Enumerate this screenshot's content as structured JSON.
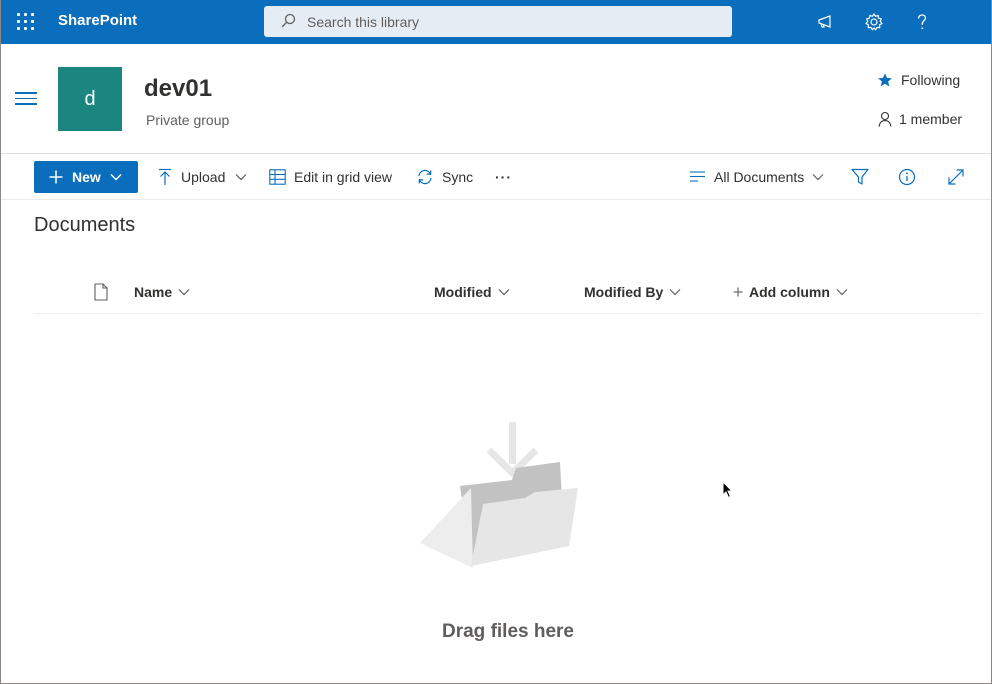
{
  "suite_bar": {
    "brand": "SharePoint",
    "search_placeholder": "Search this library",
    "icons": [
      "app-launcher-icon",
      "megaphone-icon",
      "gear-icon",
      "help-icon"
    ]
  },
  "site": {
    "logo_letter": "d",
    "title": "dev01",
    "subtitle": "Private group",
    "logo_color": "#1b8580",
    "following_label": "Following",
    "members_label": "1 member"
  },
  "command_bar": {
    "new_label": "New",
    "upload_label": "Upload",
    "grid_label": "Edit in grid view",
    "sync_label": "Sync",
    "more_label": "···",
    "view_label": "All Documents"
  },
  "library": {
    "title": "Documents",
    "columns": {
      "name": "Name",
      "modified": "Modified",
      "modified_by": "Modified By",
      "add_column": "Add column"
    },
    "empty_message": "Drag files here"
  },
  "colors": {
    "accent": "#0a6ebd",
    "text": "#323130",
    "muted": "#605e5c"
  }
}
